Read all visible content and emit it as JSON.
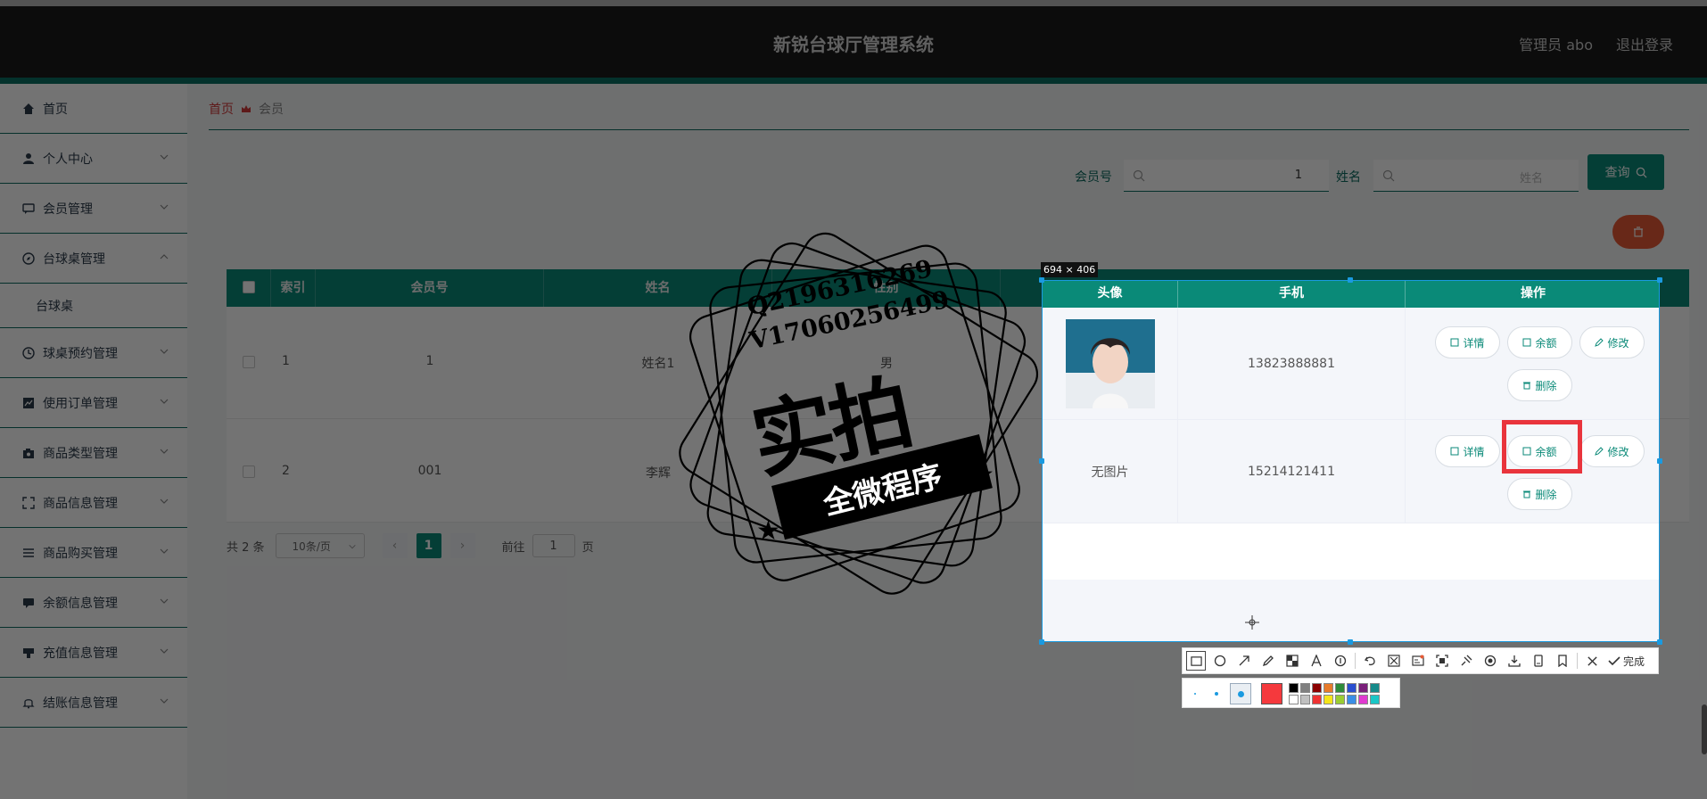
{
  "header": {
    "title": "新锐台球厅管理系统",
    "admin": "管理员 abo",
    "logout": "退出登录"
  },
  "sidebar": {
    "items": [
      {
        "label": "首页",
        "icon": "home-icon"
      },
      {
        "label": "个人中心",
        "icon": "user-icon"
      },
      {
        "label": "会员管理",
        "icon": "chat-icon"
      },
      {
        "label": "台球桌管理",
        "icon": "compass-icon"
      },
      {
        "label": "台球桌",
        "icon": ""
      },
      {
        "label": "球桌预约管理",
        "icon": "clock-icon"
      },
      {
        "label": "使用订单管理",
        "icon": "chart-icon"
      },
      {
        "label": "商品类型管理",
        "icon": "camera-icon"
      },
      {
        "label": "商品信息管理",
        "icon": "fullscreen-icon"
      },
      {
        "label": "商品购买管理",
        "icon": "list-icon"
      },
      {
        "label": "余额信息管理",
        "icon": "message-icon"
      },
      {
        "label": "充值信息管理",
        "icon": "receipt-icon"
      },
      {
        "label": "结账信息管理",
        "icon": "bell-icon"
      }
    ]
  },
  "breadcrumb": {
    "home": "首页",
    "current": "会员"
  },
  "search": {
    "member_label": "会员号",
    "member_value": "1",
    "name_label": "姓名",
    "name_placeholder": "姓名",
    "query_label": "查询"
  },
  "table": {
    "headers": [
      "索引",
      "会员号",
      "姓名",
      "性别"
    ],
    "rows": [
      {
        "index": "1",
        "member": "1",
        "name": "姓名1",
        "gender": "男"
      },
      {
        "index": "2",
        "member": "001",
        "name": "李辉",
        "gender": ""
      }
    ]
  },
  "pager": {
    "total": "共 2 条",
    "page_size": "10条/页",
    "current": "1",
    "goto_label": "前往",
    "goto_value": "1",
    "page_suffix": "页"
  },
  "capture": {
    "size": "694 × 406",
    "headers": [
      "头像",
      "手机",
      "操作"
    ],
    "rows": [
      {
        "avatar": "",
        "phone": "13823888881"
      },
      {
        "avatar": "无图片",
        "phone": "15214121411"
      }
    ],
    "actions": {
      "detail": "详情",
      "balance": "余额",
      "edit": "修改",
      "delete": "删除"
    },
    "done": "完成"
  },
  "watermark": {
    "line1": "Q2196316269",
    "line2": "V17060256499",
    "big": "实拍",
    "ribbon": "全微程序"
  },
  "colors": {
    "accent": "#0b8a78",
    "highlight": "#e9343c",
    "selection": "#1a9ae0"
  }
}
